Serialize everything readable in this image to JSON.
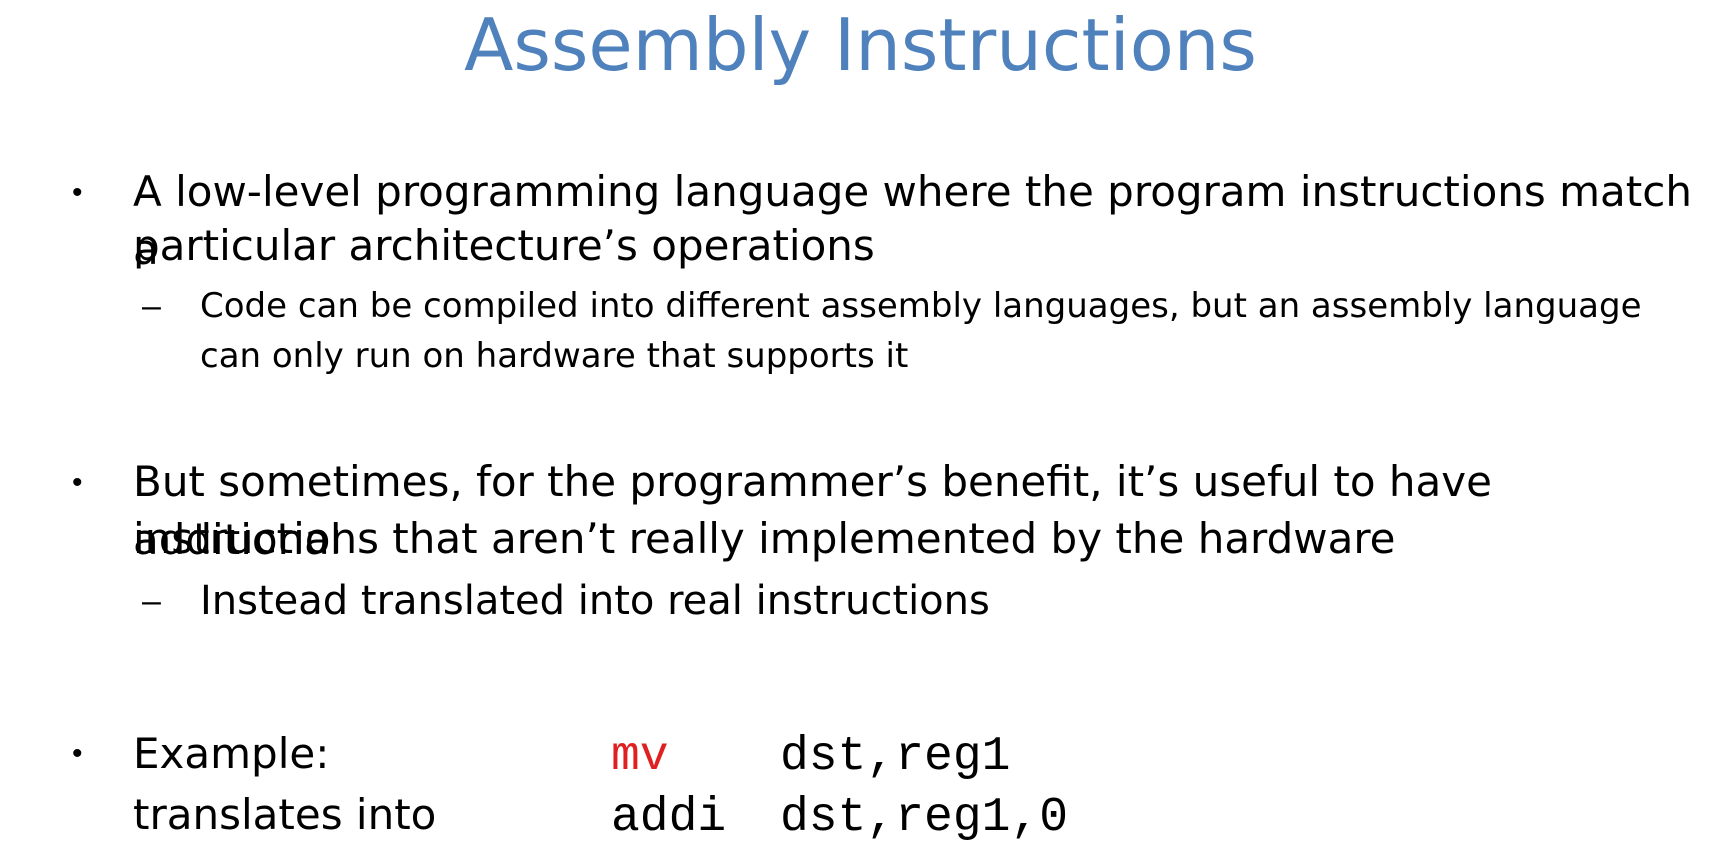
{
  "slide": {
    "title": "Assembly Instructions",
    "bullets": [
      {
        "symbol": "•",
        "text": "A low-level programming language where the program instructions match a particular architecture’s operations",
        "line1": "A low-level programming language where the program instructions match a",
        "line2": "particular architecture’s operations",
        "sub": {
          "symbol": "–",
          "line1": "Code can be compiled into different assembly languages, but an assembly language",
          "line2": "can only run on hardware that supports it"
        }
      },
      {
        "symbol": "•",
        "line1": "But sometimes, for the programmer’s benefit, it’s useful to have additional",
        "line2": "instructions that aren’t really implemented by the hardware",
        "sub": {
          "symbol": "–",
          "line1": "Instead translated into real instructions"
        }
      },
      {
        "symbol": "•",
        "line1": "Example:",
        "line2": "translates into",
        "code1_op": "mv",
        "code1_args": "dst,reg1",
        "code2_op": "addi",
        "code2_args": "dst,reg1,0"
      }
    ]
  },
  "colors": {
    "title": "#4F81BD",
    "highlight_op": "#E02020",
    "text": "#000000"
  }
}
